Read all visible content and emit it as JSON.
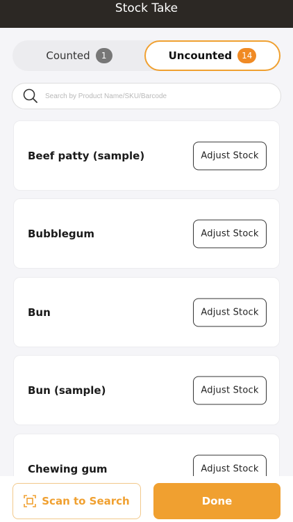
{
  "header": {
    "title": "Stock Take"
  },
  "tabs": {
    "counted": {
      "label": "Counted",
      "count": "1"
    },
    "uncounted": {
      "label": "Uncounted",
      "count": "14",
      "selected": true
    }
  },
  "search": {
    "placeholder": "Search by Product Name/SKU/Barcode",
    "icon": "search-icon"
  },
  "products": [
    {
      "name": "Beef patty (sample)",
      "action": "Adjust Stock"
    },
    {
      "name": "Bubblegum",
      "action": "Adjust Stock"
    },
    {
      "name": "Bun",
      "action": "Adjust Stock"
    },
    {
      "name": "Bun (sample)",
      "action": "Adjust Stock"
    },
    {
      "name": "Chewing gum",
      "action": "Adjust Stock"
    }
  ],
  "footer": {
    "scan_label": "Scan to Search",
    "scan_icon": "scan-icon",
    "done_label": "Done"
  },
  "colors": {
    "accent": "#f0a030",
    "header_bg": "#2c2824",
    "badge_gray": "#777777",
    "badge_orange": "#f08a24"
  }
}
